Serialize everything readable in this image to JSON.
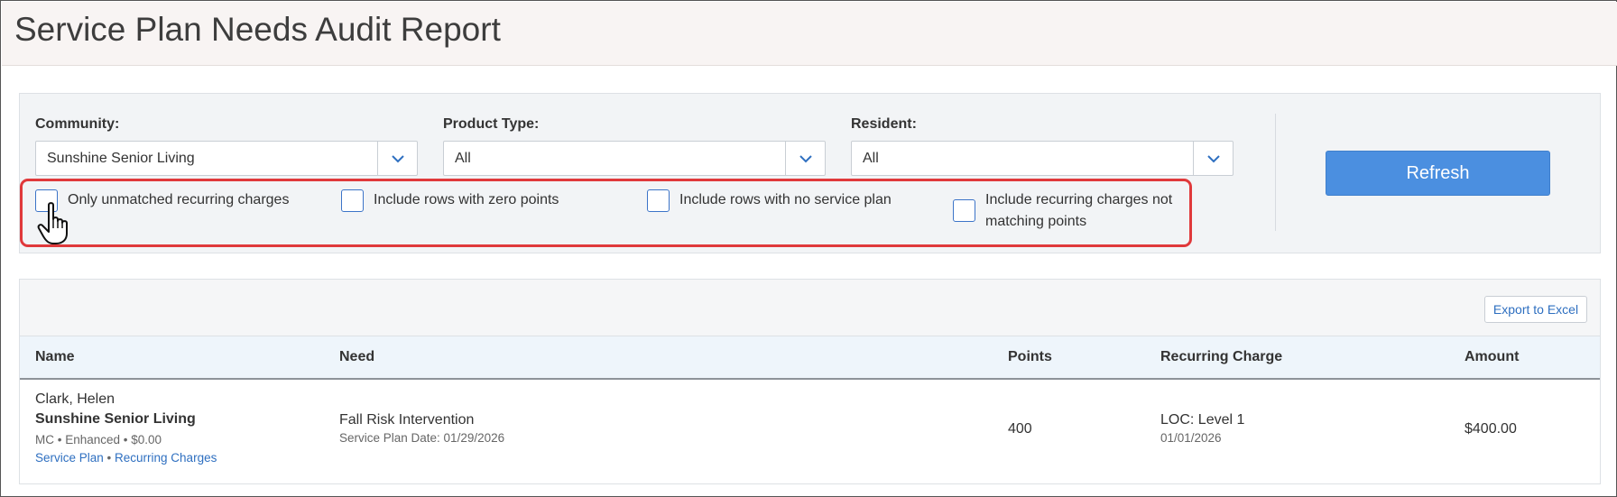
{
  "page": {
    "title": "Service Plan Needs Audit Report"
  },
  "filters": {
    "community": {
      "label": "Community:",
      "value": "Sunshine Senior Living"
    },
    "product_type": {
      "label": "Product Type:",
      "value": "All"
    },
    "resident": {
      "label": "Resident:",
      "value": "All"
    },
    "refresh_label": "Refresh",
    "checkboxes": [
      {
        "label": "Only unmatched recurring charges",
        "checked": false
      },
      {
        "label": "Include rows with zero points",
        "checked": false
      },
      {
        "label": "Include rows with no service plan",
        "checked": false
      },
      {
        "label_line1": "Include recurring charges not",
        "label_line2": "matching points",
        "checked": false
      }
    ]
  },
  "table": {
    "export_label": "Export to Excel",
    "columns": [
      "Name",
      "Need",
      "Points",
      "Recurring Charge",
      "Amount"
    ],
    "rows": [
      {
        "name": "Clark, Helen",
        "community": "Sunshine Senior Living",
        "details": "MC • Enhanced • $0.00",
        "link_service_plan": "Service Plan",
        "link_sep": " • ",
        "link_recurring": "Recurring Charges",
        "need": "Fall Risk Intervention",
        "need_sub": "Service Plan Date: 01/29/2026",
        "points": "400",
        "charge": "LOC: Level 1",
        "charge_date": "01/01/2026",
        "amount": "$400.00"
      }
    ]
  },
  "colors": {
    "accent": "#4b8fe0",
    "link": "#2e6fc0",
    "highlight": "#e0393b"
  }
}
